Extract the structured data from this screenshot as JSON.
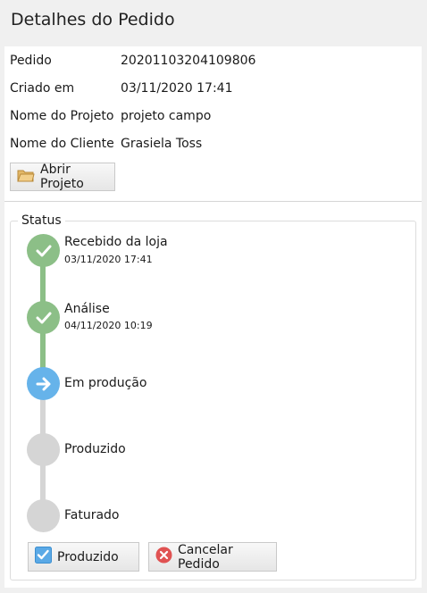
{
  "window": {
    "title": "Detalhes do Pedido"
  },
  "order": {
    "fields": [
      {
        "label": "Pedido",
        "value": "20201103204109806"
      },
      {
        "label": "Criado em",
        "value": "03/11/2020 17:41"
      },
      {
        "label": "Nome do Projeto",
        "value": "projeto campo"
      },
      {
        "label": "Nome do Cliente",
        "value": "Grasiela Toss"
      }
    ],
    "open_project_label": "Abrir Projeto"
  },
  "status": {
    "legend": "Status",
    "steps": [
      {
        "title": "Recebido da loja",
        "date": "03/11/2020 17:41",
        "state": "done"
      },
      {
        "title": "Análise",
        "date": "04/11/2020 10:19",
        "state": "done"
      },
      {
        "title": "Em produção",
        "date": "",
        "state": "current"
      },
      {
        "title": "Produzido",
        "date": "",
        "state": "pending"
      },
      {
        "title": "Faturado",
        "date": "",
        "state": "pending"
      }
    ]
  },
  "actions": {
    "produced_label": "Produzido",
    "cancel_label": "Cancelar Pedido"
  },
  "colors": {
    "done": "#8cbf87",
    "current": "#66b3ea",
    "pending": "#d5d5d5",
    "cancel": "#e05252"
  }
}
